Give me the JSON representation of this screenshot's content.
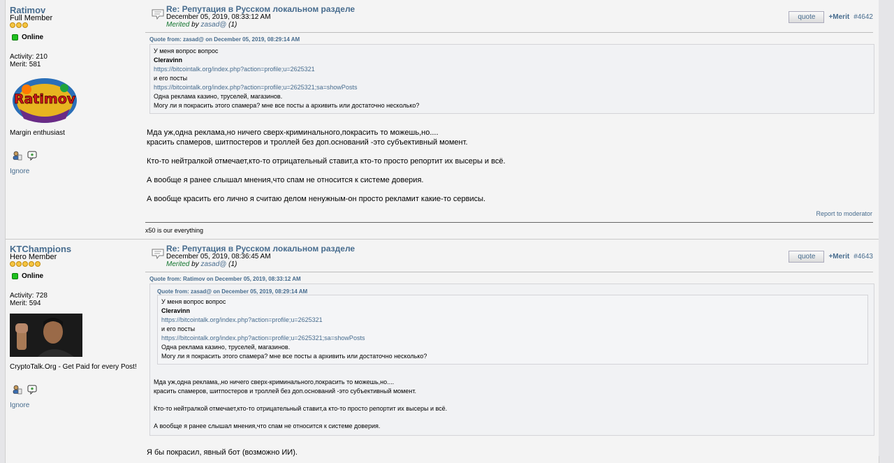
{
  "posts": [
    {
      "author": "Ratimov",
      "rank": "Full Member",
      "stars": 3,
      "status": "Online",
      "activity": "Activity: 210",
      "merit": "Merit: 581",
      "avatar_text": "Ratimov",
      "signature_short": "Margin enthusiast",
      "ignore": "Ignore",
      "subject": "Re: Репутация в Русском локальном разделе",
      "date": "December 05, 2019, 08:33:12 AM",
      "merited_label": "Merited",
      "merited_by": "by",
      "merited_user": "zasad@",
      "merited_count": "(1)",
      "quote_button": "quote",
      "merit_button": "+Merit",
      "post_number": "#4642",
      "quote_header": "Quote from: zasad@ on December 05, 2019, 08:29:14 AM",
      "quote_lines": [
        "У меня вопрос вопрос",
        "Cleravinn",
        "https://bitcointalk.org/index.php?action=profile;u=2625321",
        "и его посты",
        "https://bitcointalk.org/index.php?action=profile;u=2625321;sa=showPosts",
        "Одна реклама казино, труселей, магазинов.",
        "Могу ли я покрасить этого спамера? мне все посты а архивить или достаточно несколько?"
      ],
      "body": [
        "Мда уж,одна реклама,но ничего сверх-криминального,покрасить то можешь,но....",
        "красить спамеров, шитпостеров и троллей без доп.оснований -это субъективный момент.",
        "Кто-то нейтралкой отмечает,кто-то отрицательный ставит,а кто-то просто репортит их высеры и всё.",
        "А вообще я ранее слышал мнения,что спам не относится к системе доверия.",
        "А вообще красить его лично я считаю делом ненужным-он просто рекламит какие-то сервисы."
      ],
      "report": "Report to moderator",
      "signature": "x50 is our everything"
    },
    {
      "author": "KTChampions",
      "rank": "Hero Member",
      "stars": 5,
      "status": "Online",
      "activity": "Activity: 728",
      "merit": "Merit: 594",
      "signature_short": "CryptoTalk.Org - Get Paid for every Post!",
      "ignore": "Ignore",
      "subject": "Re: Репутация в Русском локальном разделе",
      "date": "December 05, 2019, 08:36:45 AM",
      "merited_label": "Merited",
      "merited_by": "by",
      "merited_user": "zasad@",
      "merited_count": "(1)",
      "quote_button": "quote",
      "merit_button": "+Merit",
      "post_number": "#4643",
      "outer_quote_header": "Quote from: Ratimov on December 05, 2019, 08:33:12 AM",
      "inner_quote_header": "Quote from: zasad@ on December 05, 2019, 08:29:14 AM",
      "inner_quote_lines": [
        "У меня вопрос вопрос",
        "Cleravinn",
        "https://bitcointalk.org/index.php?action=profile;u=2625321",
        "и его посты",
        "https://bitcointalk.org/index.php?action=profile;u=2625321;sa=showPosts",
        "Одна реклама казино, труселей, магазинов.",
        "Могу ли я покрасить этого спамера? мне все посты а архивить или достаточно несколько?"
      ],
      "outer_quote_lines": [
        "Мда уж,одна реклама,,но ничего сверх-криминального,покрасить то можешь,но....",
        "красить спамеров, шитпостеров и троллей без доп.оснований -это субъективный момент.",
        "Кто-то нейтралкой отмечает,кто-то отрицательный ставит,а кто-то просто репортит их высеры и всё.",
        "А вообще я ранее слышал мнения,что спам не относится к системе доверия."
      ],
      "body": [
        "Я бы покрасил, явный бот (возможно ИИ)."
      ]
    }
  ]
}
